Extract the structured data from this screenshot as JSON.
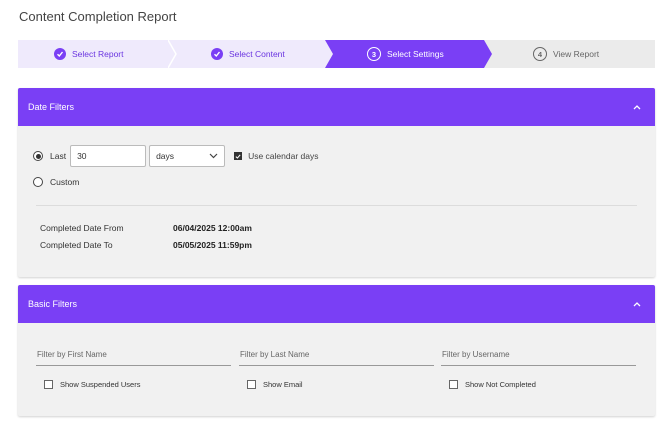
{
  "page": {
    "title": "Content Completion Report"
  },
  "stepper": {
    "steps": [
      {
        "label": "Select Report",
        "state": "done"
      },
      {
        "label": "Select Content",
        "state": "done"
      },
      {
        "number": "3",
        "label": "Select Settings",
        "state": "active"
      },
      {
        "number": "4",
        "label": "View Report",
        "state": "pending"
      }
    ]
  },
  "date_filters": {
    "title": "Date Filters",
    "last_label": "Last",
    "last_value": "30",
    "unit_value": "days",
    "calendar_label": "Use calendar days",
    "calendar_checked": true,
    "custom_label": "Custom",
    "from_label": "Completed Date From",
    "from_value": "06/04/2025 12:00am",
    "to_label": "Completed Date To",
    "to_value": "05/05/2025 11:59pm"
  },
  "basic_filters": {
    "title": "Basic Filters",
    "first_name_placeholder": "Filter by First Name",
    "last_name_placeholder": "Filter by Last Name",
    "username_placeholder": "Filter by Username",
    "suspended_label": "Show Suspended Users",
    "email_label": "Show Email",
    "not_completed_label": "Show Not Completed"
  },
  "colors": {
    "accent": "#7a3ff5",
    "step_done_bg": "#efeafc",
    "step_pending_bg": "#ebebeb"
  }
}
